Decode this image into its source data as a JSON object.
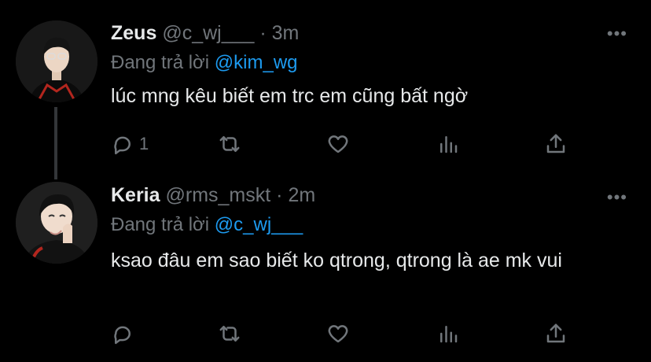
{
  "tweets": [
    {
      "name": "Zeus",
      "handle": "@c_wj___",
      "separator": "·",
      "time": "3m",
      "reply_prefix": "Đang trả lời",
      "reply_to": "@kim_wg",
      "text": "lúc mng kêu biết em trc em cũng bất ngờ",
      "reply_count": "1",
      "more_icon": "more-dots-icon"
    },
    {
      "name": "Keria",
      "handle": "@rms_mskt",
      "separator": "·",
      "time": "2m",
      "reply_prefix": "Đang trả lời",
      "reply_to": "@c_wj___",
      "text": "ksao đâu em sao biết ko qtrong, qtrong là ae mk vui",
      "reply_count": "",
      "more_icon": "more-dots-icon"
    }
  ],
  "colors": {
    "background": "#000000",
    "primary_text": "#e7e9ea",
    "secondary_text": "#71767b",
    "accent": "#1d9bf0"
  },
  "action_icons": [
    "reply-icon",
    "retweet-icon",
    "like-icon",
    "analytics-icon",
    "share-icon"
  ]
}
